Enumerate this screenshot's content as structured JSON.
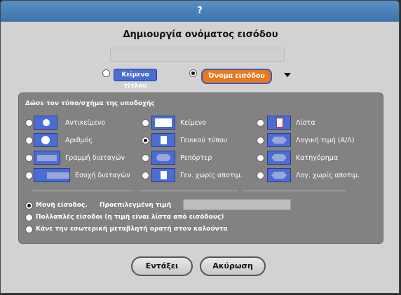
{
  "window": {
    "title": "?"
  },
  "dialog": {
    "heading": "Δημιουργία ονόματος εισόδου",
    "name_value": "",
    "modes": [
      {
        "label": "Κείμενο τίτλου",
        "selected": false
      },
      {
        "label": "Όνομα εισόδου",
        "selected": true
      }
    ]
  },
  "types": {
    "heading": "Δώσε τον τύπο/σχήμα της υποδοχής",
    "options": [
      {
        "label": "Αντικείμενο",
        "icon": "sprite-icon",
        "selected": false
      },
      {
        "label": "Κείμενο",
        "icon": "text-slot-icon",
        "selected": false
      },
      {
        "label": "Λίστα",
        "icon": "list-icon",
        "selected": false
      },
      {
        "label": "Αριθμός",
        "icon": "number-slot-icon",
        "selected": false
      },
      {
        "label": "Γενικού τύπου",
        "icon": "any-slot-icon",
        "selected": true
      },
      {
        "label": "Λογική τιμή (Α/Λ)",
        "icon": "boolean-slot-icon",
        "selected": false
      },
      {
        "label": "Γραμμή διαταγών",
        "icon": "command-inline-icon",
        "selected": false
      },
      {
        "label": "Ρεπόρτερ",
        "icon": "reporter-icon",
        "selected": false
      },
      {
        "label": "Κατηγόρημα",
        "icon": "predicate-icon",
        "selected": false
      },
      {
        "label": "Εσοχή διαταγών",
        "icon": "command-c-icon",
        "selected": false
      },
      {
        "label": "Γεν. χωρίς αποτιμ.",
        "icon": "any-unevaluated-icon",
        "selected": false
      },
      {
        "label": "Λογ. χωρίς αποτιμ.",
        "icon": "boolean-unevaluated-icon",
        "selected": false
      }
    ]
  },
  "input_kind": {
    "single": {
      "label": "Μονή είσοδος.",
      "selected": true
    },
    "default_label": "Προεπιλεγμένη τιμή",
    "default_value": "",
    "multiple": {
      "label": "Πολλαπλές είσοδοι (η τιμή είναι λίστα από εισόδους)",
      "selected": false
    },
    "upvar": {
      "label": "Κάνε την εσωτερική μεταβλητή ορατή στον καλούντα",
      "selected": false
    }
  },
  "buttons": {
    "ok": "Εντάξει",
    "cancel": "Ακύρωση"
  }
}
